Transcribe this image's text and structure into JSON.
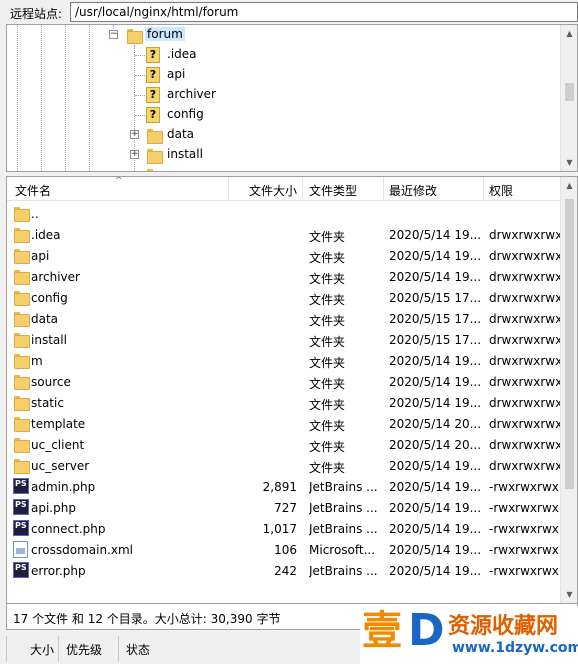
{
  "remote_site": {
    "label": "远程站点:",
    "path": "/usr/local/nginx/html/forum"
  },
  "tree": {
    "current": "forum",
    "items": [
      {
        "name": ".idea",
        "icon": "unknown-folder-icon"
      },
      {
        "name": "api",
        "icon": "unknown-folder-icon"
      },
      {
        "name": "archiver",
        "icon": "unknown-folder-icon"
      },
      {
        "name": "config",
        "icon": "unknown-folder-icon"
      },
      {
        "name": "data",
        "icon": "folder-icon"
      },
      {
        "name": "install",
        "icon": "folder-icon"
      }
    ]
  },
  "columns": {
    "name": "文件名",
    "size": "文件大小",
    "type": "文件类型",
    "modified": "最近修改",
    "perms": "权限"
  },
  "files": [
    {
      "name": "..",
      "size": "",
      "type": "",
      "modified": "",
      "perms": "",
      "icon": "folder"
    },
    {
      "name": ".idea",
      "size": "",
      "type": "文件夹",
      "modified": "2020/5/14 19...",
      "perms": "drwxrwxrwx",
      "icon": "folder"
    },
    {
      "name": "api",
      "size": "",
      "type": "文件夹",
      "modified": "2020/5/14 19...",
      "perms": "drwxrwxrwx",
      "icon": "folder"
    },
    {
      "name": "archiver",
      "size": "",
      "type": "文件夹",
      "modified": "2020/5/14 19...",
      "perms": "drwxrwxrwx",
      "icon": "folder"
    },
    {
      "name": "config",
      "size": "",
      "type": "文件夹",
      "modified": "2020/5/15 17...",
      "perms": "drwxrwxrwx",
      "icon": "folder"
    },
    {
      "name": "data",
      "size": "",
      "type": "文件夹",
      "modified": "2020/5/15 17...",
      "perms": "drwxrwxrwx",
      "icon": "folder"
    },
    {
      "name": "install",
      "size": "",
      "type": "文件夹",
      "modified": "2020/5/15 17...",
      "perms": "drwxrwxrwx",
      "icon": "folder"
    },
    {
      "name": "m",
      "size": "",
      "type": "文件夹",
      "modified": "2020/5/14 19...",
      "perms": "drwxrwxrwx",
      "icon": "folder"
    },
    {
      "name": "source",
      "size": "",
      "type": "文件夹",
      "modified": "2020/5/14 19...",
      "perms": "drwxrwxrwx",
      "icon": "folder"
    },
    {
      "name": "static",
      "size": "",
      "type": "文件夹",
      "modified": "2020/5/14 19...",
      "perms": "drwxrwxrwx",
      "icon": "folder"
    },
    {
      "name": "template",
      "size": "",
      "type": "文件夹",
      "modified": "2020/5/14 20...",
      "perms": "drwxrwxrwx",
      "icon": "folder"
    },
    {
      "name": "uc_client",
      "size": "",
      "type": "文件夹",
      "modified": "2020/5/14 20...",
      "perms": "drwxrwxrwx",
      "icon": "folder"
    },
    {
      "name": "uc_server",
      "size": "",
      "type": "文件夹",
      "modified": "2020/5/14 19...",
      "perms": "drwxrwxrwx",
      "icon": "folder"
    },
    {
      "name": "admin.php",
      "size": "2,891",
      "type": "JetBrains ...",
      "modified": "2020/5/14 19...",
      "perms": "-rwxrwxrwx",
      "icon": "php"
    },
    {
      "name": "api.php",
      "size": "727",
      "type": "JetBrains ...",
      "modified": "2020/5/14 19...",
      "perms": "-rwxrwxrwx",
      "icon": "php"
    },
    {
      "name": "connect.php",
      "size": "1,017",
      "type": "JetBrains ...",
      "modified": "2020/5/14 19...",
      "perms": "-rwxrwxrwx",
      "icon": "php"
    },
    {
      "name": "crossdomain.xml",
      "size": "106",
      "type": "Microsoft...",
      "modified": "2020/5/14 19...",
      "perms": "-rwxrwxrwx",
      "icon": "xml"
    },
    {
      "name": "error.php",
      "size": "242",
      "type": "JetBrains ...",
      "modified": "2020/5/14 19...",
      "perms": "-rwxrwxrwx",
      "icon": "php"
    }
  ],
  "status": "17 个文件 和 12 个目录。大小总计: 30,390 字节",
  "bottom_tabs": [
    "大小",
    "优先级",
    "状态"
  ],
  "icon_labels": {
    "php": "PS"
  },
  "watermark": {
    "char": "壹",
    "letter": "D",
    "title": "资源收藏网",
    "url": "www.1dzyw.com"
  },
  "colors": {
    "selection": "#cce8ff",
    "folder": "#f5cf6a",
    "watermark_orange": "#f08a00",
    "watermark_blue": "#1a66c4"
  }
}
